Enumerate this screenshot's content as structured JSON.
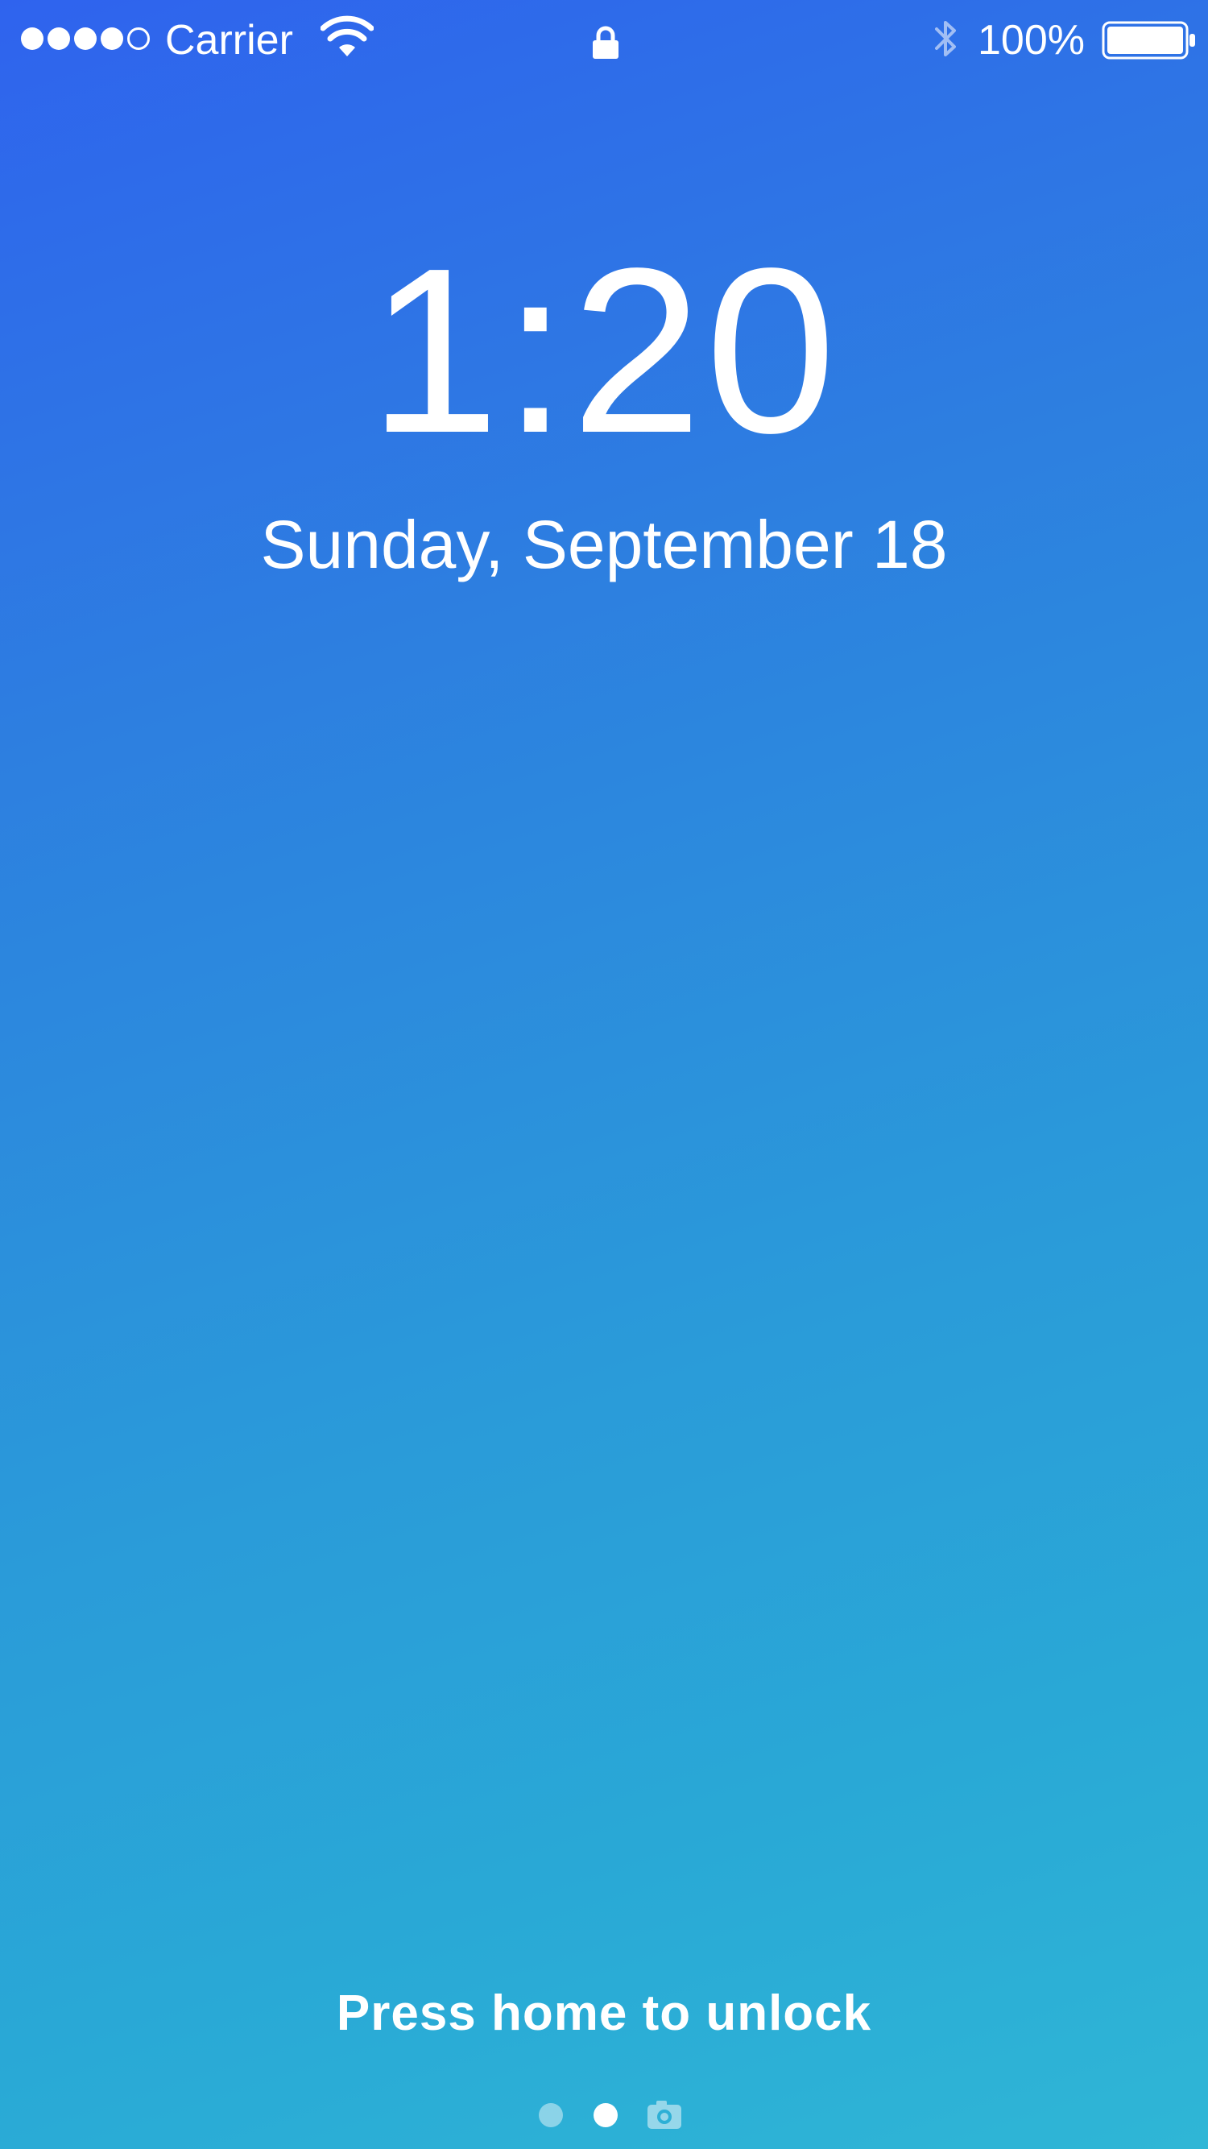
{
  "status_bar": {
    "signal_bars_filled": 4,
    "signal_bars_total": 5,
    "carrier": "Carrier",
    "wifi_icon": "wifi-icon",
    "lock_icon": "lock-icon",
    "bluetooth_icon": "bluetooth-icon",
    "battery_percent": "100%",
    "battery_level": 1.0
  },
  "lock_screen": {
    "time": "1:20",
    "date": "Sunday, September 18",
    "unlock_hint": "Press home to unlock"
  },
  "page_indicator": {
    "pages": 2,
    "current_page": 2,
    "camera_icon": "camera-icon"
  },
  "colors": {
    "gradient_top": "#2f63ee",
    "gradient_bottom": "#2fb6d6",
    "text": "#ffffff"
  }
}
